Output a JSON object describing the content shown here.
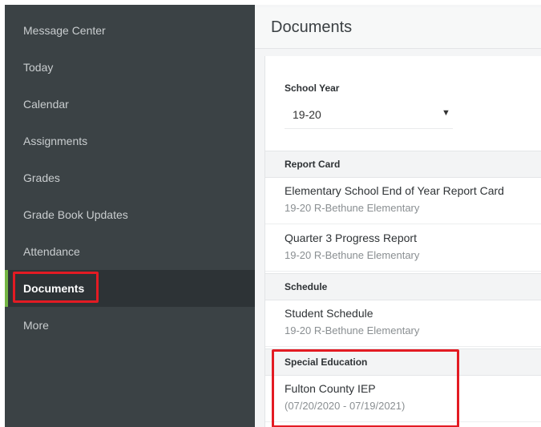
{
  "sidebar": {
    "items": [
      {
        "label": "Message Center",
        "active": false
      },
      {
        "label": "Today",
        "active": false
      },
      {
        "label": "Calendar",
        "active": false
      },
      {
        "label": "Assignments",
        "active": false
      },
      {
        "label": "Grades",
        "active": false
      },
      {
        "label": "Grade Book Updates",
        "active": false
      },
      {
        "label": "Attendance",
        "active": false
      },
      {
        "label": "Documents",
        "active": true
      },
      {
        "label": "More",
        "active": false
      }
    ]
  },
  "header": {
    "title": "Documents"
  },
  "school_year": {
    "label": "School Year",
    "value": "19-20",
    "caret": "▼"
  },
  "sections": [
    {
      "heading": "Report Card",
      "documents": [
        {
          "title": "Elementary School End of Year Report Card",
          "subtitle": "19-20 R-Bethune Elementary"
        },
        {
          "title": "Quarter 3 Progress Report",
          "subtitle": "19-20 R-Bethune Elementary"
        }
      ]
    },
    {
      "heading": "Schedule",
      "documents": [
        {
          "title": "Student Schedule",
          "subtitle": "19-20 R-Bethune Elementary"
        }
      ]
    },
    {
      "heading": "Special Education",
      "documents": [
        {
          "title": "Fulton County IEP",
          "subtitle": "(07/20/2020 - 07/19/2021)"
        }
      ]
    }
  ],
  "colors": {
    "sidebar_bg": "#3b4245",
    "active_accent": "#74b544",
    "highlight": "#e31b23"
  }
}
